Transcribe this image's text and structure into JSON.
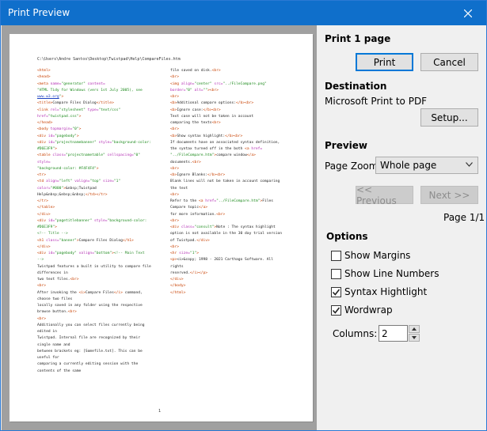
{
  "window": {
    "title": "Print Preview"
  },
  "preview": {
    "file_path": "C:\\Users\\Andre Santos\\Desktop\\Twistpad\\Help\\CompareFiles.htm",
    "page_number": "1",
    "left_column": [
      [
        [
          "tag",
          "<html>"
        ]
      ],
      [
        [
          "tag",
          "<head>"
        ]
      ],
      [
        [
          "tag",
          "<meta "
        ],
        [
          "attr",
          "name="
        ],
        [
          "val",
          "\"generator\""
        ],
        [
          "attr",
          " content="
        ]
      ],
      [
        [
          "val",
          "\"HTML Tidy for Windows (vers 1st July 2005), see"
        ]
      ],
      [
        [
          "link",
          "www.w3.org"
        ],
        [
          "val",
          "\""
        ],
        [
          "tag",
          ">"
        ]
      ],
      [
        [
          "tag",
          "<title>"
        ],
        [
          "text",
          "Compare Files Dialog"
        ],
        [
          "tag",
          "</title>"
        ]
      ],
      [
        [
          "tag",
          "<link "
        ],
        [
          "attr",
          "rel="
        ],
        [
          "val",
          "\"stylesheet\""
        ],
        [
          "attr",
          " type="
        ],
        [
          "val",
          "\"text/css\""
        ]
      ],
      [
        [
          "attr",
          "href="
        ],
        [
          "val",
          "\"twistpad.css\""
        ],
        [
          "tag",
          ">"
        ]
      ],
      [
        [
          "tag",
          "</head>"
        ]
      ],
      [
        [
          "tag",
          "<body "
        ],
        [
          "attr",
          "topmargin="
        ],
        [
          "val",
          "\"0\""
        ],
        [
          "tag",
          ">"
        ]
      ],
      [
        [
          "tag",
          "<div "
        ],
        [
          "attr",
          "id="
        ],
        [
          "val",
          "\"pagebody\""
        ],
        [
          "tag",
          ">"
        ]
      ],
      [
        [
          "tag",
          "<div "
        ],
        [
          "attr",
          "id="
        ],
        [
          "val",
          "\"projectnamebanner\""
        ],
        [
          "attr",
          " style="
        ],
        [
          "val",
          "\"background-color:"
        ]
      ],
      [
        [
          "val",
          "#D6E3F9\""
        ],
        [
          "tag",
          ">"
        ]
      ],
      [
        [
          "tag",
          "<table "
        ],
        [
          "attr",
          "class="
        ],
        [
          "val",
          "\"projectnametable\""
        ],
        [
          "attr",
          " cellspacing="
        ],
        [
          "val",
          "\"0\""
        ]
      ],
      [
        [
          "attr",
          "style="
        ]
      ],
      [
        [
          "val",
          "\"background-color: #F4F4F4\""
        ],
        [
          "tag",
          ">"
        ]
      ],
      [
        [
          "tag",
          "<tr>"
        ]
      ],
      [
        [
          "tag",
          "<td "
        ],
        [
          "attr",
          "align="
        ],
        [
          "val",
          "\"left\""
        ],
        [
          "attr",
          " valign="
        ],
        [
          "val",
          "\"top\""
        ],
        [
          "attr",
          " size="
        ],
        [
          "val",
          "\"1\""
        ]
      ],
      [
        [
          "attr",
          "color="
        ],
        [
          "val",
          "\"#000\""
        ],
        [
          "tag",
          ">"
        ],
        [
          "text",
          "&nbsp;Twistpad"
        ]
      ],
      [
        [
          "text",
          "Help&nbsp;&nbsp;&nbsp;"
        ],
        [
          "tag",
          "</td></tr>"
        ]
      ],
      [
        [
          "tag",
          "</tr>"
        ]
      ],
      [
        [
          "tag",
          "</table>"
        ]
      ],
      [
        [
          "tag",
          "</div>"
        ]
      ],
      [
        [
          "tag",
          "<div "
        ],
        [
          "attr",
          "id="
        ],
        [
          "val",
          "\"pagetitlebanner\""
        ],
        [
          "attr",
          " style="
        ],
        [
          "val",
          "\"background-color:"
        ]
      ],
      [
        [
          "val",
          "#D6E3F9\""
        ],
        [
          "tag",
          ">"
        ]
      ],
      [
        [
          "com",
          "<!-- Title -->"
        ]
      ],
      [
        [
          "tag",
          "<h1 "
        ],
        [
          "attr",
          "class="
        ],
        [
          "val",
          "\"banner\""
        ],
        [
          "tag",
          ">"
        ],
        [
          "text",
          "Compare Files Dialog"
        ],
        [
          "tag",
          "</h1>"
        ]
      ],
      [
        [
          "tag",
          "</div>"
        ]
      ],
      [
        [
          "tag",
          "<div "
        ],
        [
          "attr",
          "id="
        ],
        [
          "val",
          "\"pagebody\""
        ],
        [
          "attr",
          " valign="
        ],
        [
          "val",
          "\"bottom\""
        ],
        [
          "tag",
          ">"
        ],
        [
          "com",
          "<!-- Main Text"
        ]
      ],
      [
        [
          "com",
          "-->"
        ]
      ],
      [
        [
          "text",
          "Twistpad features a built in utility to compare file"
        ]
      ],
      [
        [
          "text",
          "differences in"
        ]
      ],
      [
        [
          "text",
          "two text files."
        ],
        [
          "tag",
          "<br>"
        ]
      ],
      [
        [
          "tag",
          "<br>"
        ]
      ],
      [
        [
          "text",
          "After invoking the "
        ],
        [
          "tag",
          "<i>"
        ],
        [
          "text",
          "Compare Files"
        ],
        [
          "tag",
          "</i>"
        ],
        [
          "text",
          " command,"
        ]
      ],
      [
        [
          "text",
          "choose two files"
        ]
      ],
      [
        [
          "text",
          "locally saved in any folder using the respective"
        ]
      ],
      [
        [
          "text",
          "browse button."
        ],
        [
          "tag",
          "<br>"
        ]
      ],
      [
        [
          "tag",
          "<br>"
        ]
      ],
      [
        [
          "text",
          "Additionally you can select files currently being"
        ]
      ],
      [
        [
          "text",
          "edited in"
        ]
      ],
      [
        [
          "text",
          "Twistpad. Internal file are recognized by their"
        ]
      ],
      [
        [
          "text",
          "single name and"
        ]
      ],
      [
        [
          "text",
          "between brackets eg: [Somefile.txt]. This can be"
        ]
      ],
      [
        [
          "text",
          "useful for"
        ]
      ],
      [
        [
          "text",
          "comparing a currently editing session with the"
        ]
      ],
      [
        [
          "text",
          "contents of the same"
        ]
      ]
    ],
    "right_column": [
      [
        [
          "text",
          "file saved on disk."
        ],
        [
          "tag",
          "<br>"
        ]
      ],
      [
        [
          "tag",
          "<br>"
        ]
      ],
      [
        [
          "tag",
          "<img "
        ],
        [
          "attr",
          "align="
        ],
        [
          "val",
          "\"center\""
        ],
        [
          "attr",
          " src="
        ],
        [
          "val",
          "\"../FileCompare.png\""
        ]
      ],
      [
        [
          "attr",
          "border="
        ],
        [
          "val",
          "\"0\""
        ],
        [
          "attr",
          " alt="
        ],
        [
          "val",
          "\"\""
        ],
        [
          "tag",
          "><br>"
        ]
      ],
      [
        [
          "tag",
          "<br>"
        ]
      ],
      [
        [
          "tag",
          "<b>"
        ],
        [
          "text",
          "Additional compare options:"
        ],
        [
          "tag",
          "</b><br>"
        ]
      ],
      [
        [
          "tag",
          "<b>"
        ],
        [
          "text",
          "Ignore case:"
        ],
        [
          "tag",
          "</b><br>"
        ]
      ],
      [
        [
          "text",
          "Text case will not be taken in account"
        ]
      ],
      [
        [
          "text",
          "comparing the texts"
        ],
        [
          "tag",
          "<br>"
        ]
      ],
      [
        [
          "tag",
          "<br>"
        ]
      ],
      [
        [
          "tag",
          "<b>"
        ],
        [
          "text",
          "Show syntax highlight:"
        ],
        [
          "tag",
          "</b><br>"
        ]
      ],
      [
        [
          "text",
          "If documents have an associated syntax definition,"
        ]
      ],
      [
        [
          "text",
          "the syntax turned off in the both "
        ],
        [
          "tag",
          "<a "
        ],
        [
          "attr",
          "href="
        ]
      ],
      [
        [
          "val",
          "\"../FileCompare.htm\""
        ],
        [
          "tag",
          ">"
        ],
        [
          "text",
          "compare window"
        ],
        [
          "tag",
          "</a>"
        ]
      ],
      [
        [
          "text",
          "documents."
        ],
        [
          "tag",
          "<br>"
        ]
      ],
      [
        [
          "tag",
          "<br>"
        ]
      ],
      [
        [
          "tag",
          "<b>"
        ],
        [
          "text",
          "Ignore Blanks:"
        ],
        [
          "tag",
          "</b><br>"
        ]
      ],
      [
        [
          "text",
          "Blank lines will not be taken in account comparing"
        ]
      ],
      [
        [
          "text",
          "the text"
        ]
      ],
      [
        [
          "tag",
          "<br>"
        ]
      ],
      [
        [
          "text",
          "Refer to the "
        ],
        [
          "tag",
          "<a "
        ],
        [
          "attr",
          "href="
        ],
        [
          "val",
          "\"../FileCompare.htm\""
        ],
        [
          "tag",
          ">"
        ],
        [
          "text",
          "Files"
        ]
      ],
      [
        [
          "text",
          "Compare topic"
        ],
        [
          "tag",
          "</a>"
        ]
      ],
      [
        [
          "text",
          "for more information."
        ],
        [
          "tag",
          "<br>"
        ]
      ],
      [
        [
          "tag",
          "<br>"
        ]
      ],
      [
        [
          "tag",
          "<div "
        ],
        [
          "attr",
          "class="
        ],
        [
          "val",
          "\"consult\""
        ],
        [
          "tag",
          ">"
        ],
        [
          "text",
          "Note : The syntax highlight"
        ]
      ],
      [
        [
          "text",
          "option is not available in the 30 day trial version"
        ]
      ],
      [
        [
          "text",
          "of Twistpad."
        ],
        [
          "tag",
          "</div>"
        ]
      ],
      [
        [
          "tag",
          "<br>"
        ]
      ],
      [
        [
          "tag",
          "<hr "
        ],
        [
          "attr",
          "size="
        ],
        [
          "val",
          "\"1\""
        ],
        [
          "tag",
          ">"
        ]
      ],
      [
        [
          "tag",
          "<p>"
        ],
        [
          "text",
          "<i>&copy; 1998 - 2021 Carthago Software. All"
        ]
      ],
      [
        [
          "text",
          "rights"
        ]
      ],
      [
        [
          "text",
          "reserved."
        ],
        [
          "tag",
          "</i></p>"
        ]
      ],
      [
        [
          "tag",
          "</div>"
        ]
      ],
      [
        [
          "tag",
          "</body>"
        ]
      ],
      [
        [
          "tag",
          "</html>"
        ]
      ]
    ]
  },
  "panel": {
    "print_heading": "Print 1 page",
    "print_button": "Print",
    "cancel_button": "Cancel",
    "destination_heading": "Destination",
    "destination_value": "Microsoft Print to PDF",
    "setup_button": "Setup...",
    "preview_heading": "Preview",
    "page_zoom_label": "Page Zoom:",
    "page_zoom_value": "Whole page",
    "previous_button": "<< Previous",
    "next_button": "Next >>",
    "page_indicator": "Page 1/1",
    "options_heading": "Options",
    "show_margins": "Show Margins",
    "show_line_numbers": "Show Line Numbers",
    "syntax_highlight": "Syntax Hightlight",
    "wordwrap": "Wordwrap",
    "columns_label": "Columns:",
    "columns_value": "2"
  },
  "checkboxes": {
    "show_margins": false,
    "show_line_numbers": false,
    "syntax_highlight": true,
    "wordwrap": true
  },
  "colors": {
    "titlebar": "#0f6fcb",
    "preview_background": "#a0a0a0",
    "tag": "#c84000",
    "attribute": "#b32db3",
    "value": "#1c8a1c",
    "comment": "#2f8f2f",
    "link": "#1a3fbf"
  },
  "icons": {
    "close": "close-icon",
    "dropdown": "chevron-down-icon",
    "check": "check-icon",
    "spin_up": "caret-up-icon",
    "spin_down": "caret-down-icon"
  }
}
